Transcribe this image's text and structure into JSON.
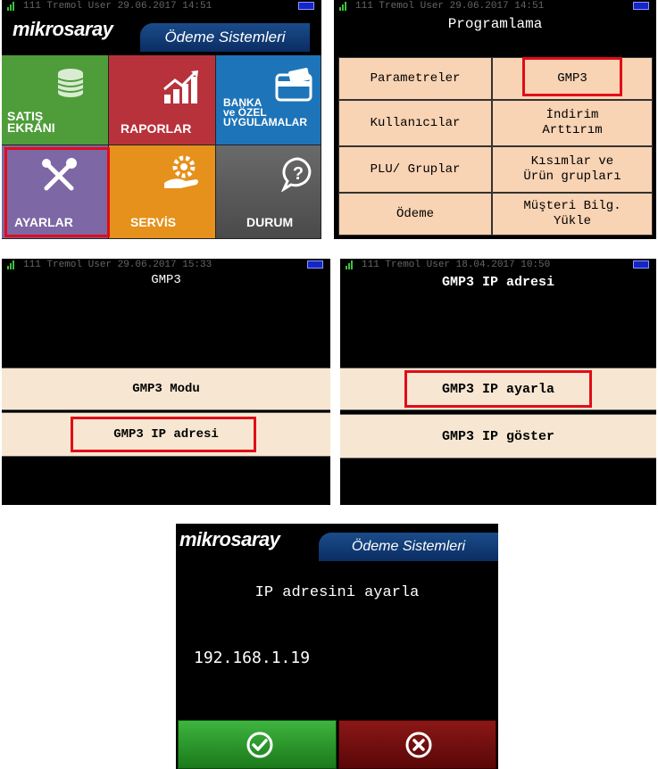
{
  "screen1": {
    "status": "111 Tremol User  29.06.2017 14:51",
    "brand": "mikrosaray",
    "brand_tab": "Ödeme Sistemleri",
    "tiles": [
      {
        "label": "SATIŞ\nEKRANI",
        "color": "#4f9d3a",
        "icon": "coins-icon"
      },
      {
        "label": "RAPORLAR",
        "color": "#b8323b",
        "icon": "chart-icon"
      },
      {
        "label": "BANKA\nve ÖZEL\nUYGULAMALAR",
        "color": "#1e74b8",
        "icon": "card-icon"
      },
      {
        "label": "AYARLAR",
        "color": "#7d67a5",
        "icon": "tools-icon"
      },
      {
        "label": "SERVİS",
        "color": "#e5911b",
        "icon": "service-icon"
      },
      {
        "label": "DURUM",
        "color": "#5a5a5a",
        "icon": "help-icon"
      }
    ]
  },
  "screen2": {
    "status": "111 Tremol User  29.06.2017 14:51",
    "title": "Programlama",
    "buttons": [
      "Parametreler",
      "GMP3",
      "Kullanıcılar",
      "İndirim\nArttırım",
      "PLU/ Gruplar",
      "Kısımlar ve\nÜrün grupları",
      "Ödeme",
      "Müşteri Bilg.\nYükle"
    ]
  },
  "screen3": {
    "status": "111 Tremol User  29.06.2017 15:33",
    "title": "GMP3",
    "items": [
      "GMP3 Modu",
      "GMP3 IP adresi"
    ]
  },
  "screen4": {
    "status": "111 Tremol User  18.04.2017 10:50",
    "title": "GMP3 IP adresi",
    "items": [
      "GMP3 IP ayarla",
      "GMP3 IP göster"
    ]
  },
  "screen5": {
    "brand": "mikrosaray",
    "brand_tab": "Ödeme Sistemleri",
    "title": "IP adresini ayarla",
    "ip_value": "192.168.1.19"
  },
  "colors": {
    "highlight": "#e10c18",
    "peach": "#f8d3b4",
    "cream": "#f7e7d2",
    "ok": "#2e9e2e",
    "cancel": "#7a1010"
  }
}
